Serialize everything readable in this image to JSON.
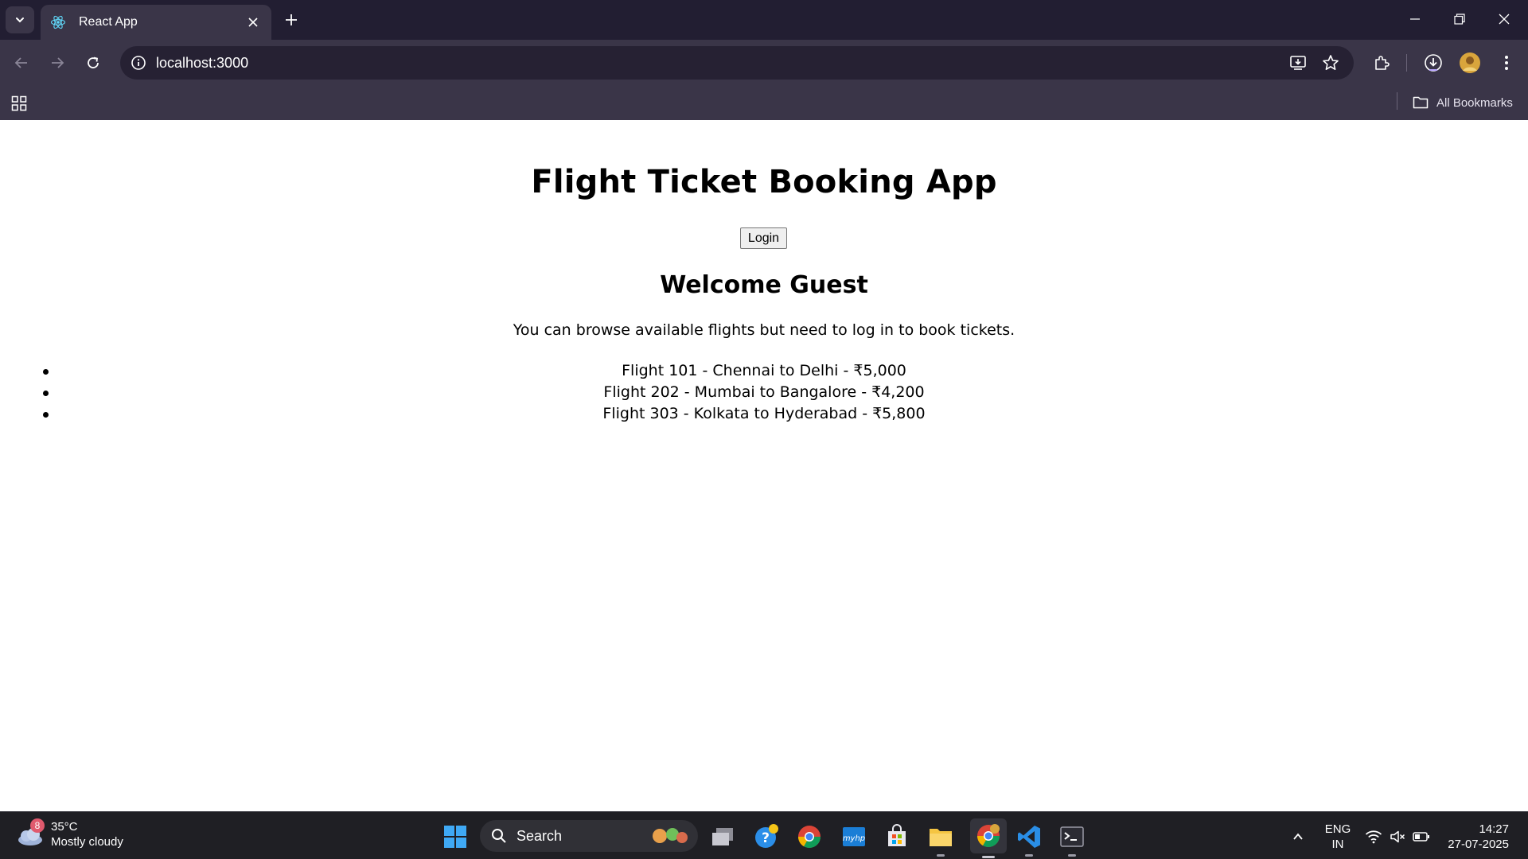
{
  "browser": {
    "tab": {
      "title": "React App",
      "icon": "react-icon"
    },
    "address": {
      "url": "localhost:3000"
    },
    "bookmarks_bar": {
      "all_bookmarks_label": "All Bookmarks"
    }
  },
  "page": {
    "title": "Flight Ticket Booking App",
    "login_button": "Login",
    "welcome_heading": "Welcome Guest",
    "info_text": "You can browse available flights but need to log in to book tickets.",
    "flights": [
      "Flight 101 - Chennai to Delhi - ₹5,000",
      "Flight 202 - Mumbai to Bangalore - ₹4,200",
      "Flight 303 - Kolkata to Hyderabad - ₹5,800"
    ]
  },
  "taskbar": {
    "weather": {
      "badge": "8",
      "temperature": "35°C",
      "condition": "Mostly cloudy"
    },
    "search_label": "Search",
    "language": {
      "line1": "ENG",
      "line2": "IN"
    },
    "clock": {
      "time": "14:27",
      "date": "27-07-2025"
    }
  },
  "colors": {
    "chrome_dark": "#221e32",
    "chrome_toolbar": "#3a3548",
    "omnibox": "#262133",
    "taskbar": "#1f1f24"
  }
}
